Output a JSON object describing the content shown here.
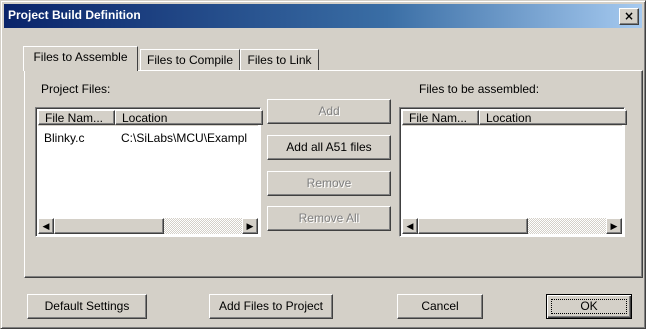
{
  "window": {
    "title": "Project Build Definition",
    "close_glyph": "×"
  },
  "tabs": [
    {
      "label": "Files to Assemble",
      "active": true
    },
    {
      "label": "Files to Compile",
      "active": false
    },
    {
      "label": "Files to Link",
      "active": false
    }
  ],
  "left_panel": {
    "label": "Project Files:",
    "columns": [
      "File Nam...",
      "Location"
    ],
    "rows": [
      {
        "file": "Blinky.c",
        "location": "C:\\SiLabs\\MCU\\Exampl"
      }
    ]
  },
  "right_panel": {
    "label": "Files to be assembled:",
    "columns": [
      "File Nam...",
      "Location"
    ],
    "rows": []
  },
  "middle_buttons": {
    "add": {
      "label": "Add",
      "enabled": false
    },
    "add_all": {
      "label": "Add all A51 files",
      "enabled": true
    },
    "remove": {
      "label": "Remove",
      "enabled": false
    },
    "remove_all": {
      "label": "Remove All",
      "enabled": false
    }
  },
  "bottom_buttons": {
    "default_settings": "Default Settings",
    "add_files": "Add Files to Project",
    "cancel": "Cancel",
    "ok": "OK"
  },
  "scroll": {
    "left_arrow": "◀",
    "right_arrow": "▶"
  },
  "colors": {
    "title_gradient_start": "#0a246a",
    "title_gradient_end": "#a6caf0",
    "face": "#d4d0c8"
  }
}
